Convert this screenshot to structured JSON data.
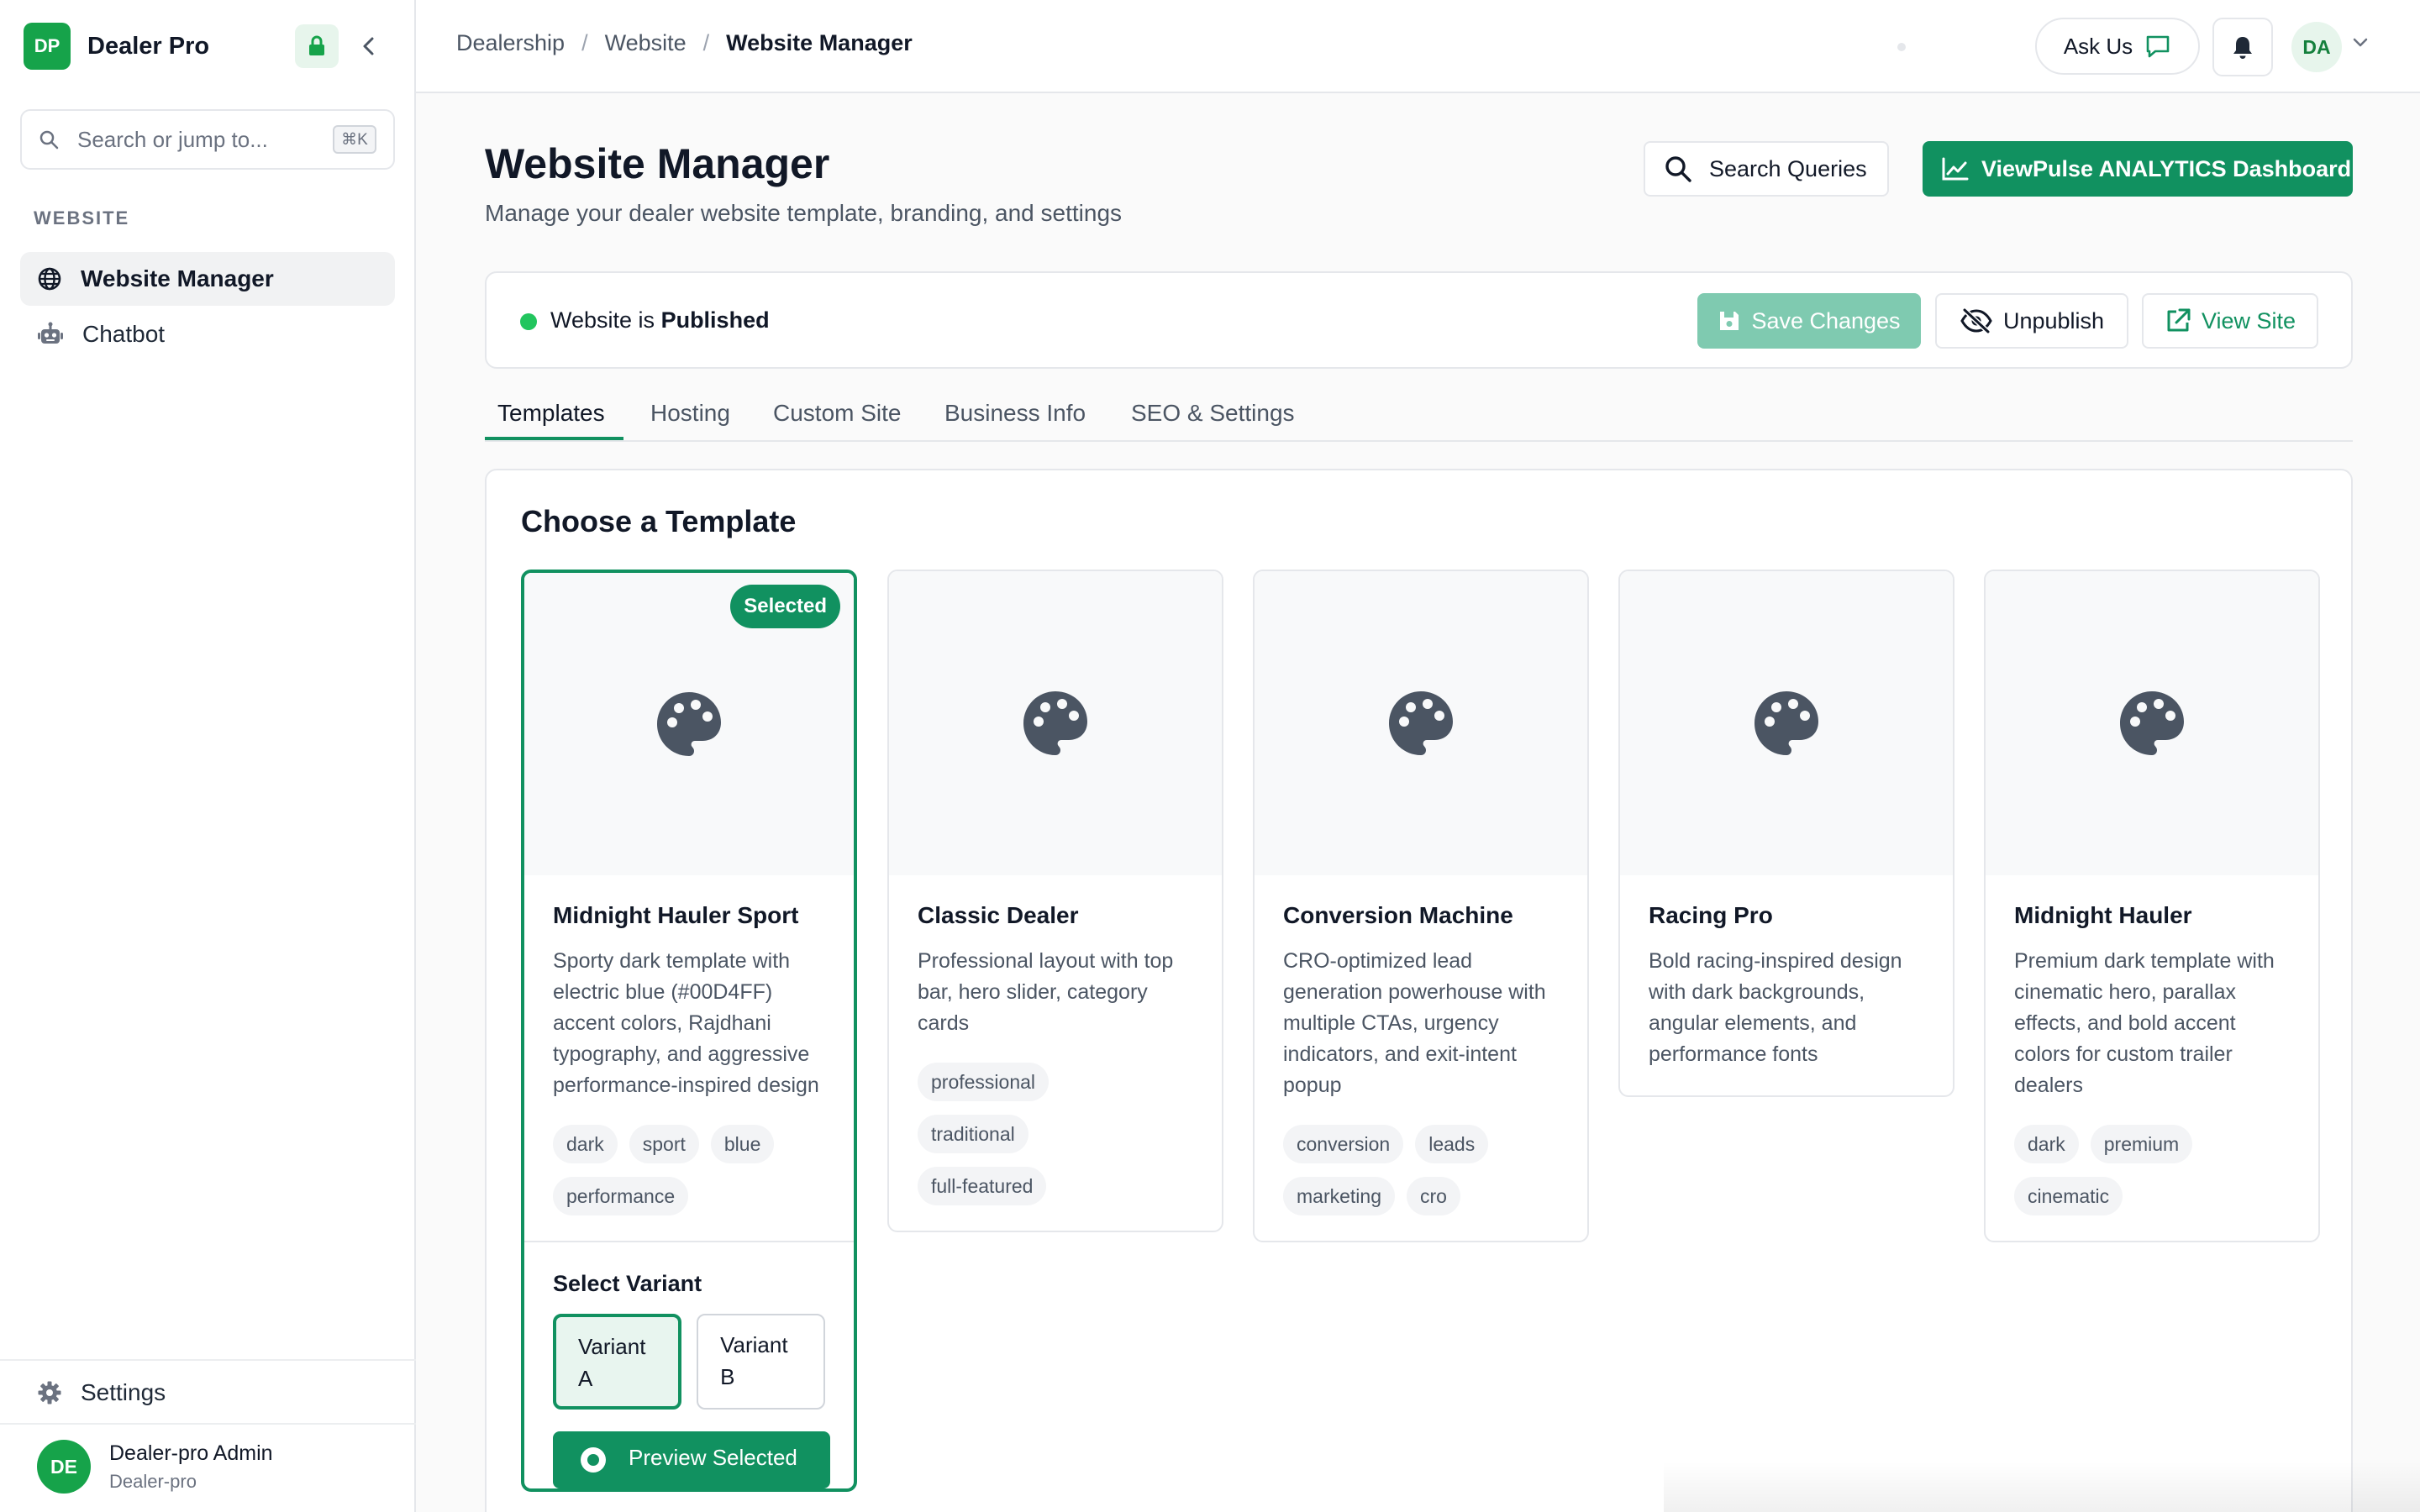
{
  "brand": {
    "initials": "DP",
    "name": "Dealer Pro"
  },
  "sidebar": {
    "search_placeholder": "Search or jump to...",
    "search_shortcut": "⌘K",
    "section_label": "WEBSITE",
    "items": [
      {
        "label": "Website Manager",
        "icon": "globe-icon",
        "active": true
      },
      {
        "label": "Chatbot",
        "icon": "robot-icon",
        "active": false
      }
    ],
    "settings_label": "Settings",
    "user": {
      "initials": "DE",
      "name": "Dealer-pro Admin",
      "org": "Dealer-pro"
    }
  },
  "topbar": {
    "breadcrumb": [
      "Dealership",
      "Website",
      "Website Manager"
    ],
    "ask_label": "Ask Us",
    "avatar_initials": "DA"
  },
  "page": {
    "title": "Website Manager",
    "subtitle": "Manage your dealer website template, branding, and settings",
    "search_queries_label": "Search Queries",
    "analytics_label": "ViewPulse ANALYTICS Dashboard"
  },
  "status": {
    "prefix": "Website is",
    "state": "Published",
    "save_label": "Save Changes",
    "unpublish_label": "Unpublish",
    "view_site_label": "View Site"
  },
  "tabs": [
    "Templates",
    "Hosting",
    "Custom Site",
    "Business Info",
    "SEO & Settings"
  ],
  "templates_panel": {
    "title": "Choose a Template",
    "selected_badge": "Selected",
    "templates": [
      {
        "name": "Midnight Hauler Sport",
        "description": "Sporty dark template with electric blue (#00D4FF) accent colors, Rajdhani typography, and aggressive performance-inspired design",
        "tags": [
          "dark",
          "sport",
          "blue",
          "performance"
        ],
        "selected": true
      },
      {
        "name": "Classic Dealer",
        "description": "Professional layout with top bar, hero slider, category cards",
        "tags": [
          "professional",
          "traditional",
          "full-featured"
        ],
        "selected": false
      },
      {
        "name": "Conversion Machine",
        "description": "CRO-optimized lead generation powerhouse with multiple CTAs, urgency indicators, and exit-intent popup",
        "tags": [
          "conversion",
          "leads",
          "marketing",
          "cro"
        ],
        "selected": false
      },
      {
        "name": "Racing Pro",
        "description": "Bold racing-inspired design with dark backgrounds, angular elements, and performance fonts",
        "tags": [],
        "selected": false
      },
      {
        "name": "Midnight Hauler",
        "description": "Premium dark template with cinematic hero, parallax effects, and bold accent colors for custom trailer dealers",
        "tags": [
          "dark",
          "premium",
          "cinematic"
        ],
        "selected": false
      }
    ],
    "variant": {
      "title": "Select Variant",
      "options": [
        {
          "line1": "Variant",
          "line2": "A",
          "active": true
        },
        {
          "line1": "Variant",
          "line2": "B",
          "active": false
        }
      ],
      "preview_label": "Preview Selected"
    }
  },
  "colors": {
    "accent": "#119160",
    "status_published": "#22c55e",
    "save_disabled": "#7fcab0"
  }
}
